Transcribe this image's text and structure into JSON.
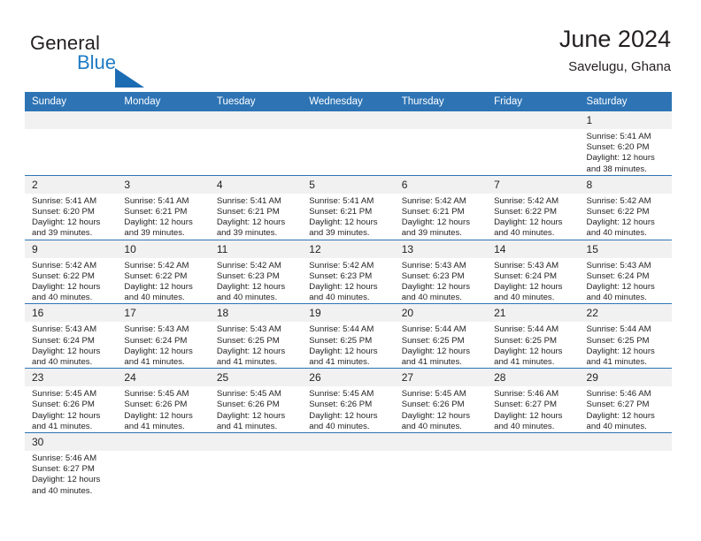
{
  "brand": {
    "line1": "General",
    "line2": "Blue",
    "flag_color": "#1c6cb3",
    "accent_color": "#1e7bc4"
  },
  "header": {
    "title": "June 2024",
    "subtitle": "Savelugu, Ghana"
  },
  "theme": {
    "header_blue": "#2e74b5",
    "daynum_band": "#f1f1f1",
    "text": "#231f20"
  },
  "weekdays": [
    "Sunday",
    "Monday",
    "Tuesday",
    "Wednesday",
    "Thursday",
    "Friday",
    "Saturday"
  ],
  "labels": {
    "sunrise_prefix": "Sunrise: ",
    "sunset_prefix": "Sunset: ",
    "daylight_prefix": "Daylight: "
  },
  "weeks": [
    [
      {
        "blank": true,
        "day": ""
      },
      {
        "blank": true,
        "day": ""
      },
      {
        "blank": true,
        "day": ""
      },
      {
        "blank": true,
        "day": ""
      },
      {
        "blank": true,
        "day": ""
      },
      {
        "blank": true,
        "day": ""
      },
      {
        "blank": false,
        "day": "1",
        "sunrise": "Sunrise: 5:41 AM",
        "sunset": "Sunset: 6:20 PM",
        "daylight_l1": "Daylight: 12 hours",
        "daylight_l2": "and 38 minutes."
      }
    ],
    [
      {
        "blank": false,
        "day": "2",
        "sunrise": "Sunrise: 5:41 AM",
        "sunset": "Sunset: 6:20 PM",
        "daylight_l1": "Daylight: 12 hours",
        "daylight_l2": "and 39 minutes."
      },
      {
        "blank": false,
        "day": "3",
        "sunrise": "Sunrise: 5:41 AM",
        "sunset": "Sunset: 6:21 PM",
        "daylight_l1": "Daylight: 12 hours",
        "daylight_l2": "and 39 minutes."
      },
      {
        "blank": false,
        "day": "4",
        "sunrise": "Sunrise: 5:41 AM",
        "sunset": "Sunset: 6:21 PM",
        "daylight_l1": "Daylight: 12 hours",
        "daylight_l2": "and 39 minutes."
      },
      {
        "blank": false,
        "day": "5",
        "sunrise": "Sunrise: 5:41 AM",
        "sunset": "Sunset: 6:21 PM",
        "daylight_l1": "Daylight: 12 hours",
        "daylight_l2": "and 39 minutes."
      },
      {
        "blank": false,
        "day": "6",
        "sunrise": "Sunrise: 5:42 AM",
        "sunset": "Sunset: 6:21 PM",
        "daylight_l1": "Daylight: 12 hours",
        "daylight_l2": "and 39 minutes."
      },
      {
        "blank": false,
        "day": "7",
        "sunrise": "Sunrise: 5:42 AM",
        "sunset": "Sunset: 6:22 PM",
        "daylight_l1": "Daylight: 12 hours",
        "daylight_l2": "and 40 minutes."
      },
      {
        "blank": false,
        "day": "8",
        "sunrise": "Sunrise: 5:42 AM",
        "sunset": "Sunset: 6:22 PM",
        "daylight_l1": "Daylight: 12 hours",
        "daylight_l2": "and 40 minutes."
      }
    ],
    [
      {
        "blank": false,
        "day": "9",
        "sunrise": "Sunrise: 5:42 AM",
        "sunset": "Sunset: 6:22 PM",
        "daylight_l1": "Daylight: 12 hours",
        "daylight_l2": "and 40 minutes."
      },
      {
        "blank": false,
        "day": "10",
        "sunrise": "Sunrise: 5:42 AM",
        "sunset": "Sunset: 6:22 PM",
        "daylight_l1": "Daylight: 12 hours",
        "daylight_l2": "and 40 minutes."
      },
      {
        "blank": false,
        "day": "11",
        "sunrise": "Sunrise: 5:42 AM",
        "sunset": "Sunset: 6:23 PM",
        "daylight_l1": "Daylight: 12 hours",
        "daylight_l2": "and 40 minutes."
      },
      {
        "blank": false,
        "day": "12",
        "sunrise": "Sunrise: 5:42 AM",
        "sunset": "Sunset: 6:23 PM",
        "daylight_l1": "Daylight: 12 hours",
        "daylight_l2": "and 40 minutes."
      },
      {
        "blank": false,
        "day": "13",
        "sunrise": "Sunrise: 5:43 AM",
        "sunset": "Sunset: 6:23 PM",
        "daylight_l1": "Daylight: 12 hours",
        "daylight_l2": "and 40 minutes."
      },
      {
        "blank": false,
        "day": "14",
        "sunrise": "Sunrise: 5:43 AM",
        "sunset": "Sunset: 6:24 PM",
        "daylight_l1": "Daylight: 12 hours",
        "daylight_l2": "and 40 minutes."
      },
      {
        "blank": false,
        "day": "15",
        "sunrise": "Sunrise: 5:43 AM",
        "sunset": "Sunset: 6:24 PM",
        "daylight_l1": "Daylight: 12 hours",
        "daylight_l2": "and 40 minutes."
      }
    ],
    [
      {
        "blank": false,
        "day": "16",
        "sunrise": "Sunrise: 5:43 AM",
        "sunset": "Sunset: 6:24 PM",
        "daylight_l1": "Daylight: 12 hours",
        "daylight_l2": "and 40 minutes."
      },
      {
        "blank": false,
        "day": "17",
        "sunrise": "Sunrise: 5:43 AM",
        "sunset": "Sunset: 6:24 PM",
        "daylight_l1": "Daylight: 12 hours",
        "daylight_l2": "and 41 minutes."
      },
      {
        "blank": false,
        "day": "18",
        "sunrise": "Sunrise: 5:43 AM",
        "sunset": "Sunset: 6:25 PM",
        "daylight_l1": "Daylight: 12 hours",
        "daylight_l2": "and 41 minutes."
      },
      {
        "blank": false,
        "day": "19",
        "sunrise": "Sunrise: 5:44 AM",
        "sunset": "Sunset: 6:25 PM",
        "daylight_l1": "Daylight: 12 hours",
        "daylight_l2": "and 41 minutes."
      },
      {
        "blank": false,
        "day": "20",
        "sunrise": "Sunrise: 5:44 AM",
        "sunset": "Sunset: 6:25 PM",
        "daylight_l1": "Daylight: 12 hours",
        "daylight_l2": "and 41 minutes."
      },
      {
        "blank": false,
        "day": "21",
        "sunrise": "Sunrise: 5:44 AM",
        "sunset": "Sunset: 6:25 PM",
        "daylight_l1": "Daylight: 12 hours",
        "daylight_l2": "and 41 minutes."
      },
      {
        "blank": false,
        "day": "22",
        "sunrise": "Sunrise: 5:44 AM",
        "sunset": "Sunset: 6:25 PM",
        "daylight_l1": "Daylight: 12 hours",
        "daylight_l2": "and 41 minutes."
      }
    ],
    [
      {
        "blank": false,
        "day": "23",
        "sunrise": "Sunrise: 5:45 AM",
        "sunset": "Sunset: 6:26 PM",
        "daylight_l1": "Daylight: 12 hours",
        "daylight_l2": "and 41 minutes."
      },
      {
        "blank": false,
        "day": "24",
        "sunrise": "Sunrise: 5:45 AM",
        "sunset": "Sunset: 6:26 PM",
        "daylight_l1": "Daylight: 12 hours",
        "daylight_l2": "and 41 minutes."
      },
      {
        "blank": false,
        "day": "25",
        "sunrise": "Sunrise: 5:45 AM",
        "sunset": "Sunset: 6:26 PM",
        "daylight_l1": "Daylight: 12 hours",
        "daylight_l2": "and 41 minutes."
      },
      {
        "blank": false,
        "day": "26",
        "sunrise": "Sunrise: 5:45 AM",
        "sunset": "Sunset: 6:26 PM",
        "daylight_l1": "Daylight: 12 hours",
        "daylight_l2": "and 40 minutes."
      },
      {
        "blank": false,
        "day": "27",
        "sunrise": "Sunrise: 5:45 AM",
        "sunset": "Sunset: 6:26 PM",
        "daylight_l1": "Daylight: 12 hours",
        "daylight_l2": "and 40 minutes."
      },
      {
        "blank": false,
        "day": "28",
        "sunrise": "Sunrise: 5:46 AM",
        "sunset": "Sunset: 6:27 PM",
        "daylight_l1": "Daylight: 12 hours",
        "daylight_l2": "and 40 minutes."
      },
      {
        "blank": false,
        "day": "29",
        "sunrise": "Sunrise: 5:46 AM",
        "sunset": "Sunset: 6:27 PM",
        "daylight_l1": "Daylight: 12 hours",
        "daylight_l2": "and 40 minutes."
      }
    ],
    [
      {
        "blank": false,
        "day": "30",
        "sunrise": "Sunrise: 5:46 AM",
        "sunset": "Sunset: 6:27 PM",
        "daylight_l1": "Daylight: 12 hours",
        "daylight_l2": "and 40 minutes."
      },
      {
        "blank": true,
        "day": ""
      },
      {
        "blank": true,
        "day": ""
      },
      {
        "blank": true,
        "day": ""
      },
      {
        "blank": true,
        "day": ""
      },
      {
        "blank": true,
        "day": ""
      },
      {
        "blank": true,
        "day": ""
      }
    ]
  ]
}
